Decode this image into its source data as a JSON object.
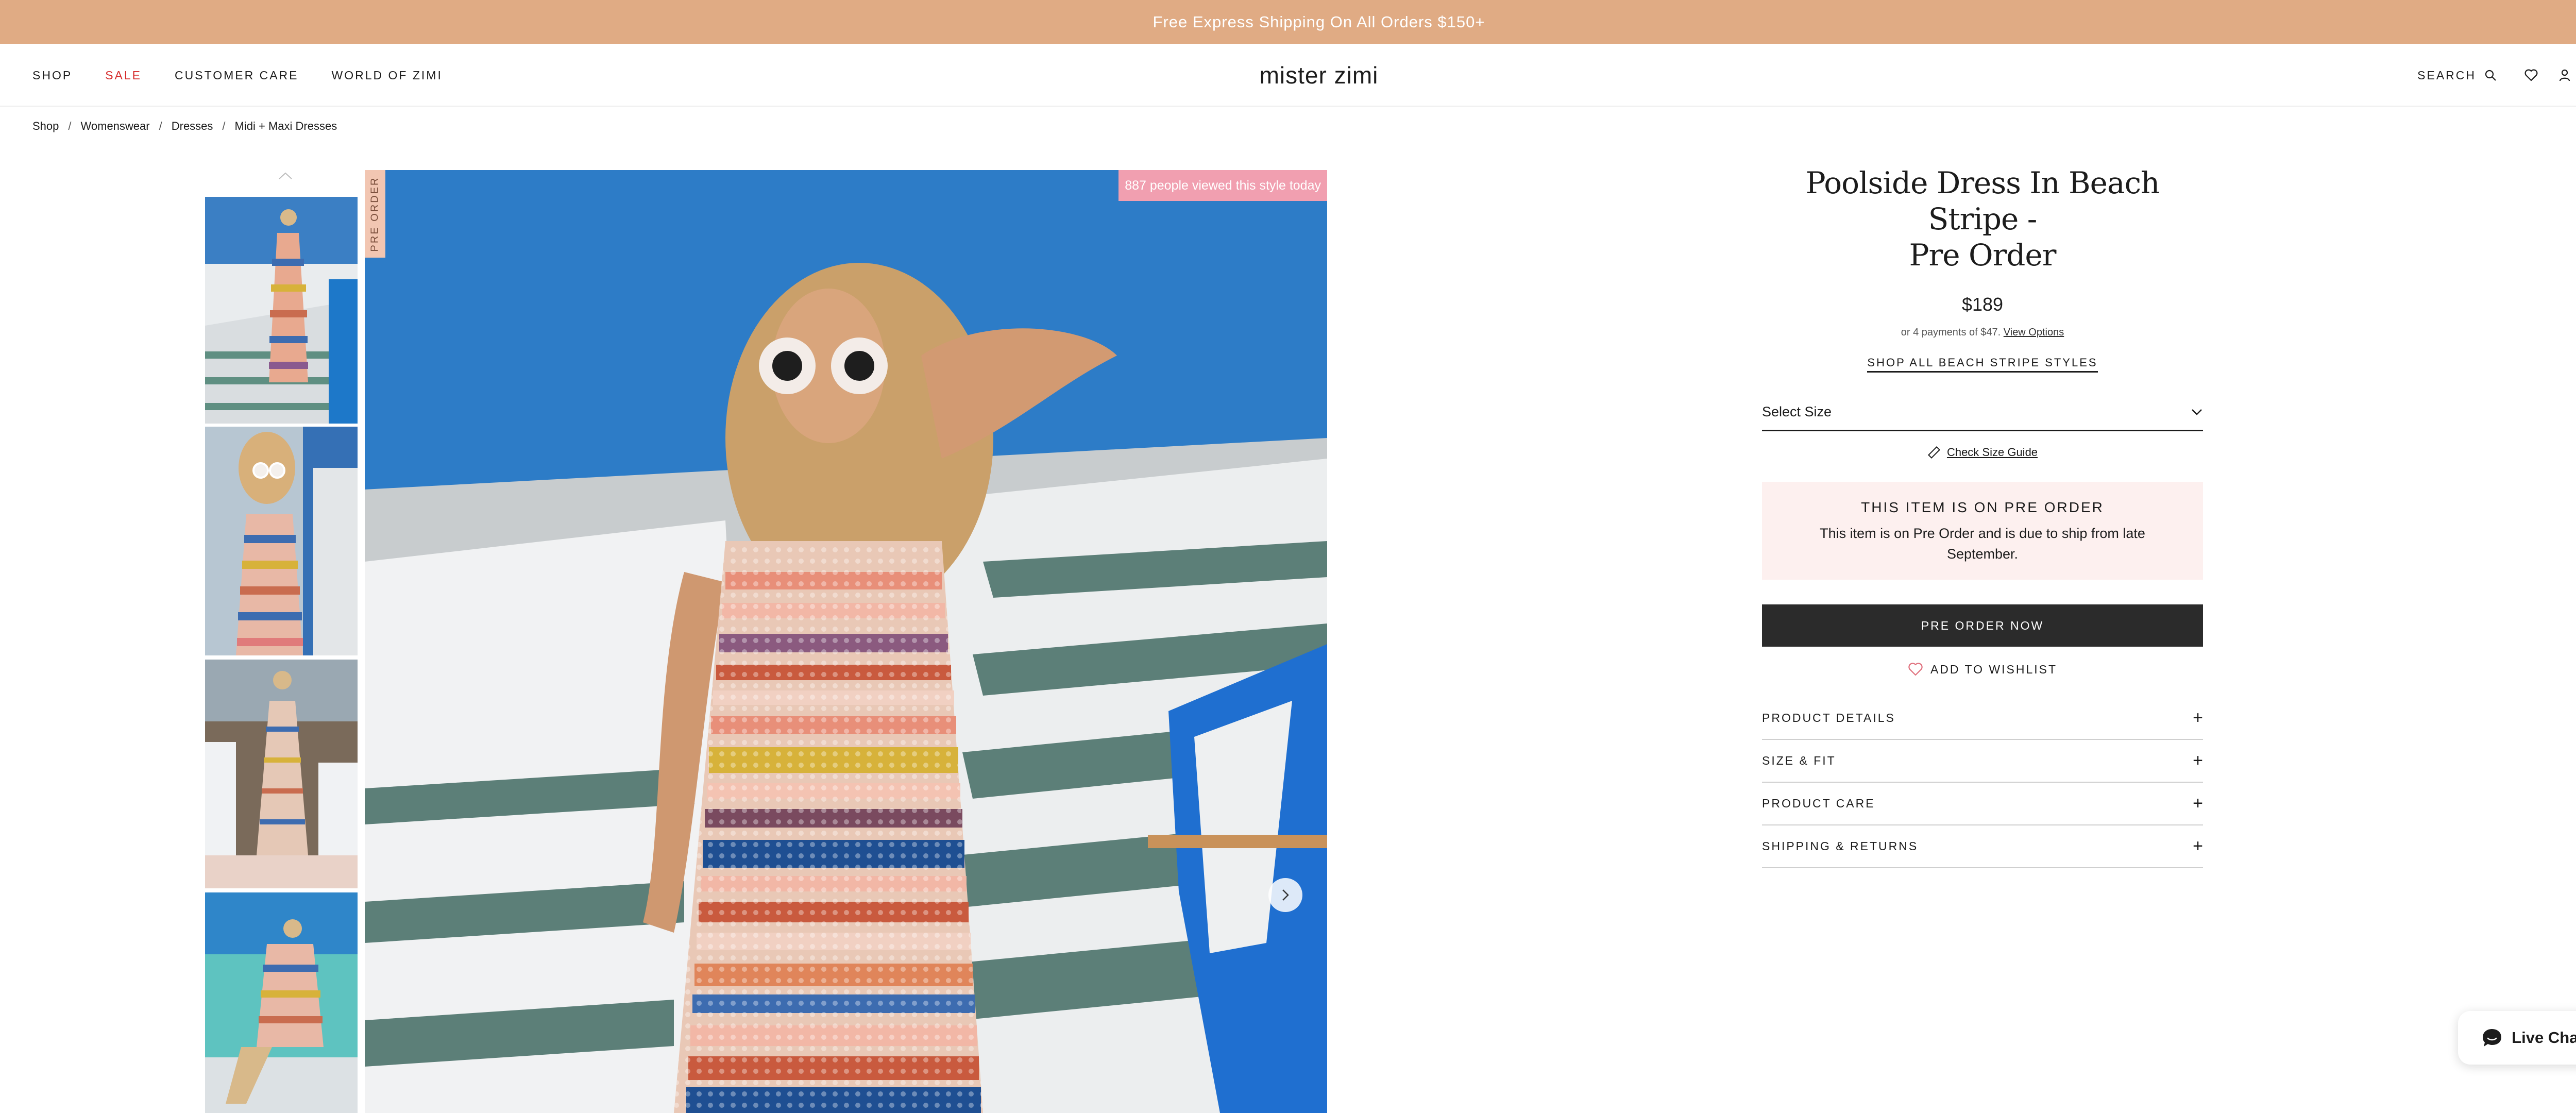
{
  "announcement": "Free Express Shipping On All Orders $150+",
  "nav": {
    "items": [
      "SHOP",
      "SALE",
      "CUSTOMER CARE",
      "WORLD OF ZIMI"
    ],
    "logo": "mister zimi",
    "search_label": "SEARCH"
  },
  "breadcrumb": [
    "Shop",
    "Womenswear",
    "Dresses",
    "Midi + Maxi Dresses"
  ],
  "gallery": {
    "preorder_tag": "PRE ORDER",
    "viewed_badge": "887 people viewed this style today"
  },
  "product": {
    "title_line1": "Poolside Dress In Beach Stripe -",
    "title_line2": "Pre Order",
    "price": "$189",
    "afterpay_text": "or 4 payments of $47.",
    "afterpay_link": "View Options",
    "shop_all": "SHOP ALL BEACH STRIPE STYLES",
    "size_select": "Select Size",
    "size_guide": "Check Size Guide",
    "preorder_heading": "THIS ITEM IS ON PRE ORDER",
    "preorder_text": "This item is on Pre Order and is due to ship from late September.",
    "preorder_button": "PRE ORDER NOW",
    "wishlist": "ADD TO WISHLIST",
    "accordion": [
      "PRODUCT DETAILS",
      "SIZE & FIT",
      "PRODUCT CARE",
      "SHIPPING & RETURNS"
    ],
    "accordion_icon": "+"
  },
  "livechat": "Live Chat",
  "colors": {
    "announce_bg": "#e0ab84",
    "sale_red": "#d62b2b",
    "badge_pink": "#f19fb0",
    "preorder_box_bg": "#fdf0ef",
    "button_dark": "#2b2b2b"
  }
}
